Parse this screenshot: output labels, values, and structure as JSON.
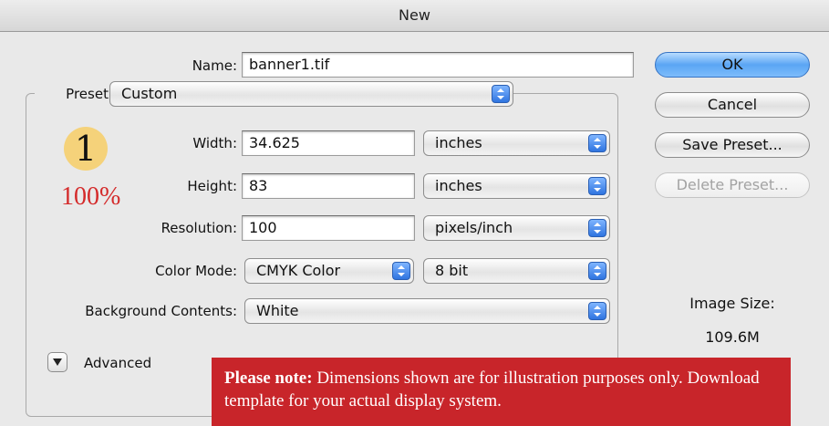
{
  "window": {
    "title": "New"
  },
  "form": {
    "name_label": "Name:",
    "name_value": "banner1.tif",
    "preset_label": "Preset:",
    "preset_value": "Custom",
    "width_label": "Width:",
    "width_value": "34.625",
    "width_unit": "inches",
    "height_label": "Height:",
    "height_value": "83",
    "height_unit": "inches",
    "resolution_label": "Resolution:",
    "resolution_value": "100",
    "resolution_unit": "pixels/inch",
    "color_mode_label": "Color Mode:",
    "color_mode_value": "CMYK Color",
    "bit_depth_value": "8 bit",
    "background_label": "Background Contents:",
    "background_value": "White",
    "advanced_label": "Advanced"
  },
  "buttons": {
    "ok": "OK",
    "cancel": "Cancel",
    "save_preset": "Save Preset...",
    "delete_preset": "Delete Preset..."
  },
  "image_size": {
    "label": "Image Size:",
    "value": "109.6M"
  },
  "overlay": {
    "step_number": "1",
    "scale": "100%",
    "note_bold": "Please note:",
    "note_text": " Dimensions shown are for illustration purposes only. Download template for your actual display system."
  },
  "colors": {
    "accent_blue": "#5aa5f4",
    "note_red": "#c8252a",
    "badge_yellow": "#f5d27a",
    "scale_red": "#d42a2a"
  },
  "icons": {
    "popup": "up-down-arrows-icon",
    "disclosure": "disclosure-triangle-icon"
  }
}
